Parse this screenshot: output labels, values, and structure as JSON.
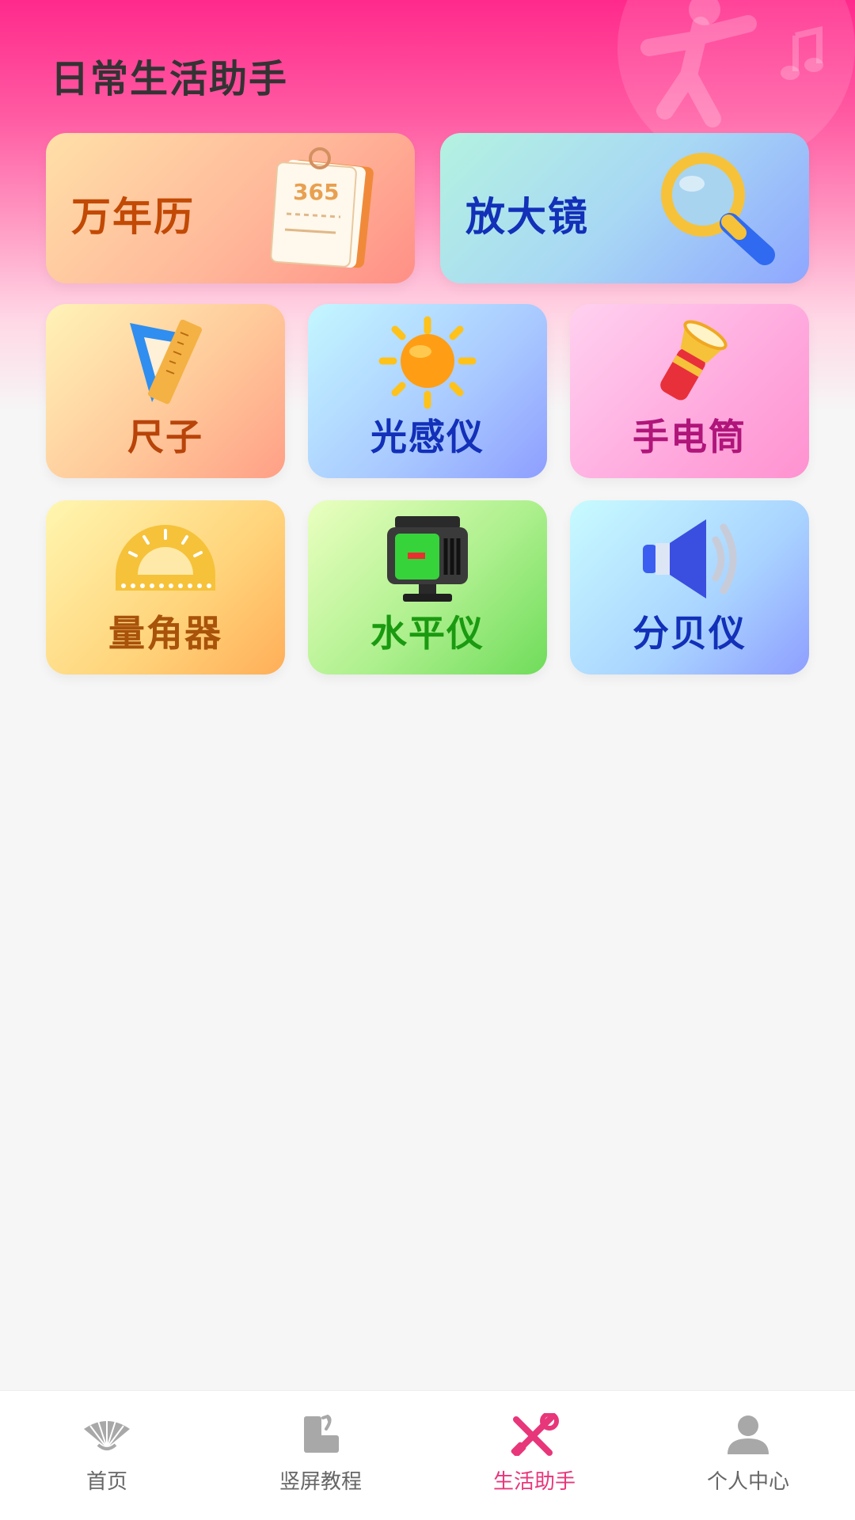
{
  "header": {
    "title": "日常生活助手"
  },
  "tools": {
    "calendar": {
      "label": "万年历",
      "badge": "365"
    },
    "magnifier": {
      "label": "放大镜"
    },
    "ruler": {
      "label": "尺子"
    },
    "light_meter": {
      "label": "光感仪"
    },
    "flashlight": {
      "label": "手电筒"
    },
    "protractor": {
      "label": "量角器"
    },
    "level": {
      "label": "水平仪"
    },
    "decibel_meter": {
      "label": "分贝仪"
    }
  },
  "bottom_nav": {
    "items": [
      {
        "label": "首页",
        "icon": "fan-icon",
        "active": false
      },
      {
        "label": "竖屏教程",
        "icon": "portrait-tutorial-icon",
        "active": false
      },
      {
        "label": "生活助手",
        "icon": "tools-icon",
        "active": true
      },
      {
        "label": "个人中心",
        "icon": "user-icon",
        "active": false
      }
    ]
  },
  "colors": {
    "accent": "#e8367a",
    "header_gradient_top": "#ff2a8c",
    "inactive_nav": "#999999"
  }
}
